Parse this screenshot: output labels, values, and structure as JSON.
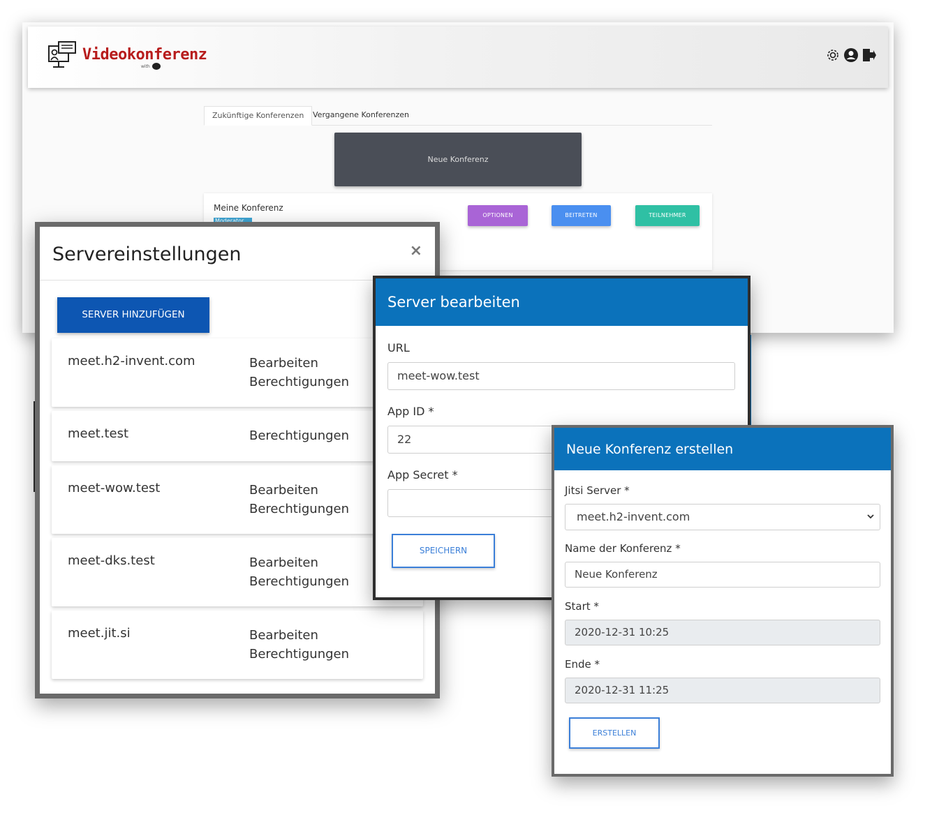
{
  "app": {
    "brand": "Videokonferenz",
    "brand_sub": "with",
    "tabs": [
      "Zukünftige Konferenzen",
      "Vergangene Konferenzen"
    ],
    "new_conference_button": "Neue Konferenz",
    "conference_card": {
      "title": "Meine Konferenz",
      "badge": "Moderator",
      "buttons": {
        "options": "OPTIONEN",
        "join": "BEITRETEN",
        "participants": "TEILNEHMER"
      }
    },
    "header_icons": [
      "gear-icon",
      "user-icon",
      "logout-icon"
    ]
  },
  "server_settings": {
    "title": "Servereinstellungen",
    "close": "×",
    "add_button": "SERVER HINZUFÜGEN",
    "servers": [
      {
        "url": "meet.h2-invent.com",
        "actions": [
          "Bearbeiten",
          "Berechtigungen"
        ]
      },
      {
        "url": "meet.test",
        "actions": [
          "Berechtigungen"
        ]
      },
      {
        "url": "meet-wow.test",
        "actions": [
          "Bearbeiten",
          "Berechtigungen"
        ]
      },
      {
        "url": "meet-dks.test",
        "actions": [
          "Bearbeiten",
          "Berechtigungen"
        ]
      },
      {
        "url": "meet.jit.si",
        "actions": [
          "Bearbeiten",
          "Berechtigungen"
        ]
      }
    ]
  },
  "edit_server": {
    "title": "Server bearbeiten",
    "url_label": "URL",
    "url_value": "meet-wow.test",
    "app_id_label": "App ID *",
    "app_id_value": "22",
    "app_secret_label": "App Secret *",
    "app_secret_value": "",
    "save_button": "SPEICHERN"
  },
  "new_conference": {
    "title": "Neue Konferenz erstellen",
    "server_label": "Jitsi Server *",
    "server_value": "meet.h2-invent.com",
    "name_label": "Name der Konferenz *",
    "name_value": "Neue Konferenz",
    "start_label": "Start *",
    "start_value": "2020-12-31 10:25",
    "end_label": "Ende *",
    "end_value": "2020-12-31 11:25",
    "create_button": "ERSTELLEN"
  },
  "peek_text": "gene Konferenzen"
}
